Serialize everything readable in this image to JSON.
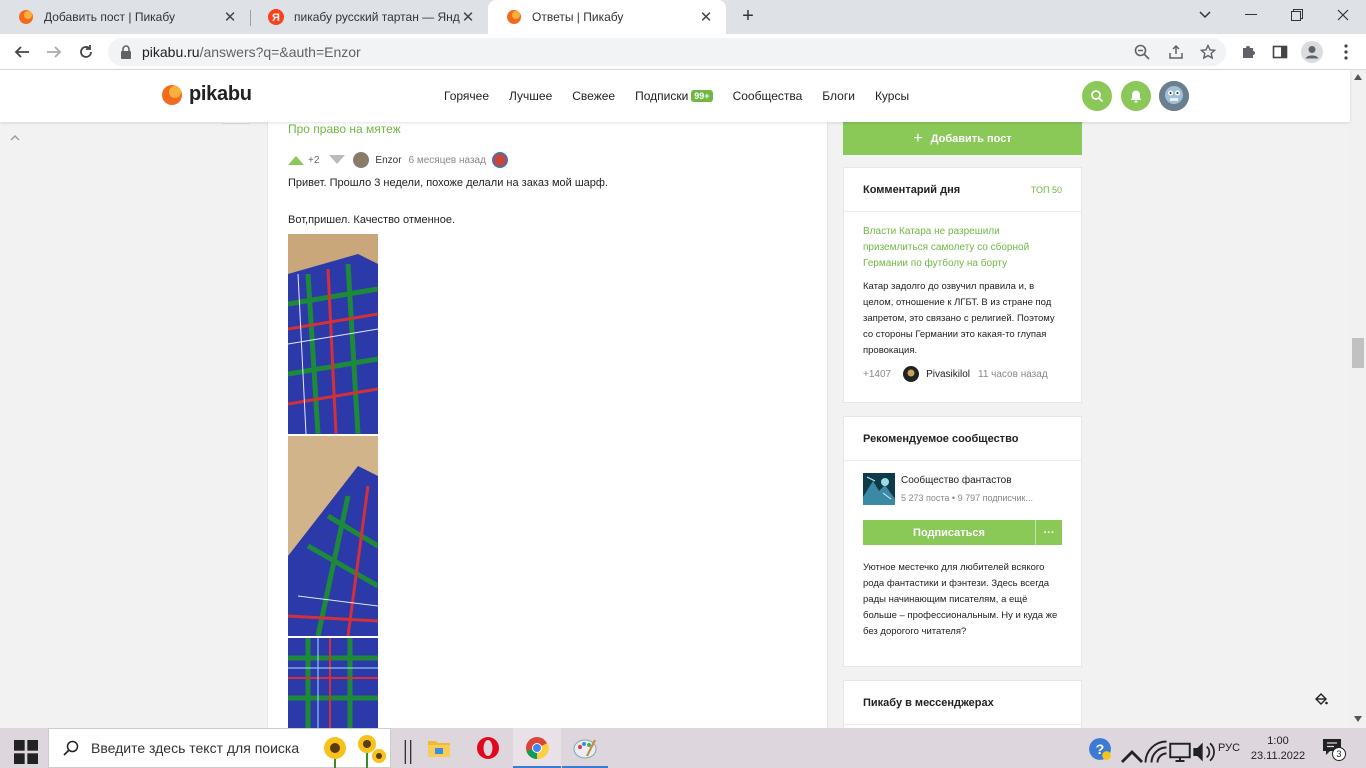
{
  "browser": {
    "tabs": [
      {
        "title": "Добавить пост | Пикабу"
      },
      {
        "title": "пикабу русский тартан — Яндекс"
      },
      {
        "title": "Ответы | Пикабу"
      }
    ],
    "url_host": "pikabu.ru",
    "url_path": "/answers?q=&auth=Enzor"
  },
  "header": {
    "logo": "pikabu",
    "nav": [
      "Горячее",
      "Лучшее",
      "Свежее",
      "Подписки",
      "Сообщества",
      "Блоги",
      "Курсы"
    ],
    "subs_badge": "99+"
  },
  "comment": {
    "post_title": "Про право на мятеж",
    "rating": "+2",
    "author": "Enzor",
    "time": "6 месяцев назад",
    "line1": "Привет. Прошло 3 недели, похоже делали на заказ мой шарф.",
    "line2": "Вот,пришел. Качество отменное."
  },
  "sidebar": {
    "add_post": "Добавить пост",
    "comment_of_day": {
      "title": "Комментарий дня",
      "top": "ТОП 50",
      "post_link": "Власти Катара не разрешили приземлиться самолету со сборной Германии по футболу на борту",
      "text": "Катар задолго до озвучил правила и, в целом, отношение к ЛГБТ. В из стране под запретом, это связано с религией. Поэтому со стороны Германии это какая-то глупая провокация.",
      "rating": "+1407",
      "author": "Pivasikilol",
      "time": "11 часов назад"
    },
    "recommended": {
      "title": "Рекомендуемое сообщество",
      "name": "Сообщество фантастов",
      "stats": "5 273 поста • 9 797 подписчик...",
      "subscribe": "Подписаться",
      "more": "···",
      "description": "Уютное местечко для любителей всякого рода фантастики и фэнтези. Здесь всегда рады начинающим писателям, а ещё больше – профессиональным. Ну и куда же без дорогого читателя?"
    },
    "messengers": {
      "title": "Пикабу в мессенджерах"
    }
  },
  "taskbar": {
    "search_placeholder": "Введите здесь текст для поиска",
    "lang": "РУС",
    "time": "1:00",
    "date": "23.11.2022",
    "notif_count": "3"
  },
  "colors": {
    "brand_green": "#8ac858",
    "link_green": "#6fb843",
    "logo_orange": "#f26b1d"
  }
}
